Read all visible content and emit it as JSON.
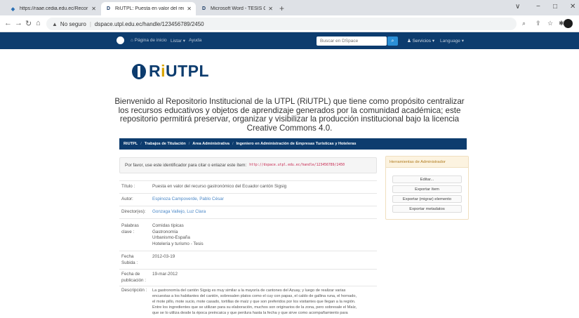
{
  "browser": {
    "tabs": [
      {
        "title": "https://raae.cedia.edu.ec/Recor",
        "active": false
      },
      {
        "title": "RiUTPL: Puesta en valor del recur",
        "active": true
      },
      {
        "title": "Microsoft Word - TESIS CD UTPL",
        "active": false
      }
    ],
    "new_tab": "+",
    "window_controls": [
      "∨",
      "−",
      "□",
      "✕"
    ],
    "security_label": "No seguro",
    "url": "dspace.utpl.edu.ec/handle/123456789/2450"
  },
  "navbar": {
    "items": [
      "Página de inicio",
      "Listar ▾",
      "Ayuda"
    ],
    "search_placeholder": "Buscar en DSpace",
    "services": "Servicios ▾",
    "language": "Language ▾"
  },
  "logo": {
    "text_r": "R",
    "text_i": "i",
    "text_rest": "UTPL"
  },
  "welcome": "Bienvenido al Repositorio Institucional de la UTPL (RiUTPL) que tiene como propósito centralizar los recursos educativos y objetos de aprendizaje generados por la comunidad académica; este repositorio permitirá preservar, organizar y visibilizar la producción institucional bajo la licencia Creative Commons 4.0.",
  "breadcrumb": [
    "RiUTPL",
    "Trabajos de Titulación",
    "Area Administrativa",
    "Ingeniero en Administración de Empresas Turísticas y Hoteleras"
  ],
  "identifier": {
    "label": "Por favor, use este identificador para citar o enlazar este ítem:",
    "uri": "http://dspace.utpl.edu.ec/handle/123456789/2450"
  },
  "metadata": {
    "titulo_label": "Título :",
    "titulo": "Puesta en valor del recurso gastronómico del Ecuador cantón Sigsig",
    "autor_label": "Autor:",
    "autor": "Espinoza Campoverde, Pablo César",
    "director_label": "Director(es):",
    "director": "Gonzaga Vallejo, Luz Clara",
    "palabras_label_1": "Palabras",
    "palabras_label_2": "clave :",
    "palabras": [
      "Comidas típicas",
      "Gastronomía",
      "Urbanismo-España",
      "Hotelería y turismo - Tesis"
    ],
    "fecha_subida_label_1": "Fecha",
    "fecha_subida_label_2": "Subida :",
    "fecha_subida": "2012-03-19",
    "fecha_pub_label_1": "Fecha de",
    "fecha_pub_label_2": "publicación :",
    "fecha_pub": "19-mar-2012",
    "descripcion_label": "Descripción :",
    "descripcion_lines": [
      "La gastronomía del cantón Sigsig es muy similar a la mayoría de cantones del Azuay, y luego de realizar varias",
      "encuestas a los habitantes del cantón, sobresalen platos como el cuy con papas, el caldo de gallina runa, el hornado,",
      "el mote pillo, mote sucio, mote casado, tortillas de maíz y que son preferidos por los visitantes que llegan a la región.",
      "Entre los ingredientes que se utilizan para su elaboración, muchos son originarios de la zona, pero sobresale el Maíz,",
      "que se lo utiliza desde la época preincaica y que perdura hasta la fecha y que sirve como acompañamiento para"
    ]
  },
  "admin": {
    "title": "Herramientas de Administrador",
    "buttons": [
      "Editar...",
      "Exportar ítem",
      "Exportar (migrar) elemento",
      "Exportar metadatos"
    ]
  }
}
